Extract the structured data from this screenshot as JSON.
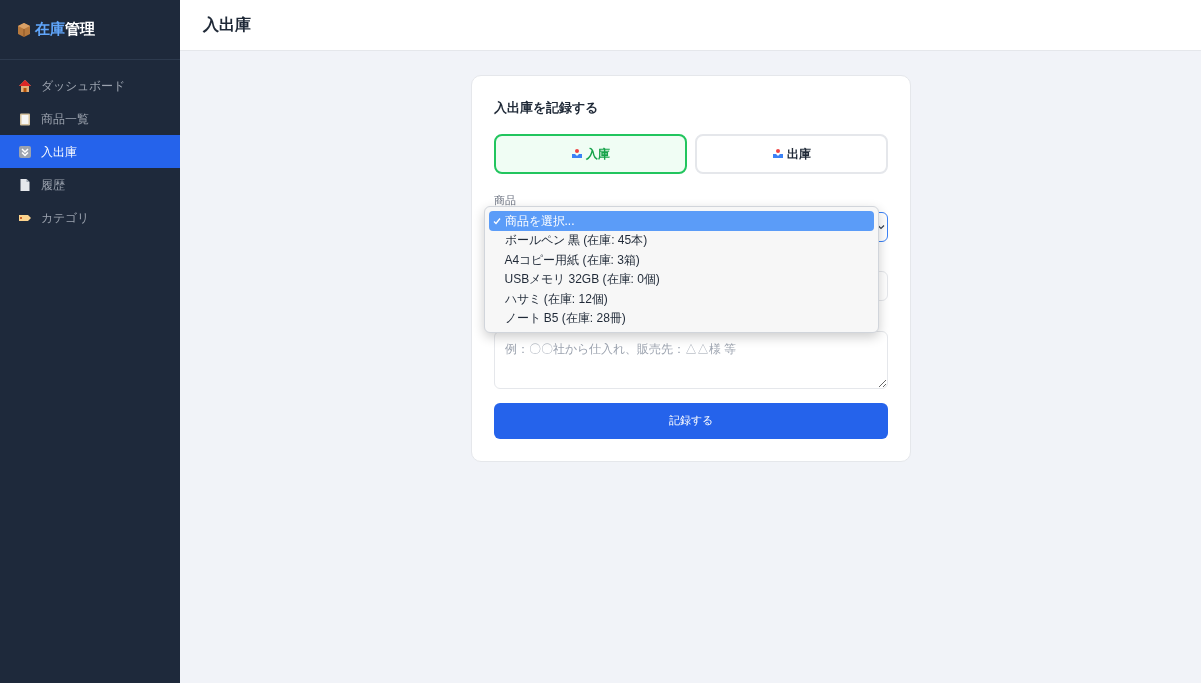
{
  "sidebar": {
    "brand": {
      "accent": "在庫",
      "rest": "管理"
    },
    "items": [
      {
        "label": "ダッシュボード",
        "selected": false
      },
      {
        "label": "商品一覧",
        "selected": false
      },
      {
        "label": "入出庫",
        "selected": true
      },
      {
        "label": "履歴",
        "selected": false
      },
      {
        "label": "カテゴリ",
        "selected": false
      }
    ]
  },
  "header": {
    "title": "入出庫"
  },
  "form": {
    "title": "入出庫を記録する",
    "modes": [
      {
        "label": "入庫",
        "selected": true
      },
      {
        "label": "出庫",
        "selected": false
      }
    ],
    "product_label": "商品",
    "product_options": [
      {
        "label": "商品を選択...",
        "selected": true
      },
      {
        "label": "ボールペン 黒 (在庫: 45本)",
        "selected": false
      },
      {
        "label": "A4コピー用紙 (在庫: 3箱)",
        "selected": false
      },
      {
        "label": "USBメモリ 32GB (在庫: 0個)",
        "selected": false
      },
      {
        "label": "ハサミ (在庫: 12個)",
        "selected": false
      },
      {
        "label": "ノート B5 (在庫: 28冊)",
        "selected": false
      }
    ],
    "notes_placeholder": "例：〇〇社から仕入れ、販売先：△△様 等",
    "submit": "記録する"
  }
}
